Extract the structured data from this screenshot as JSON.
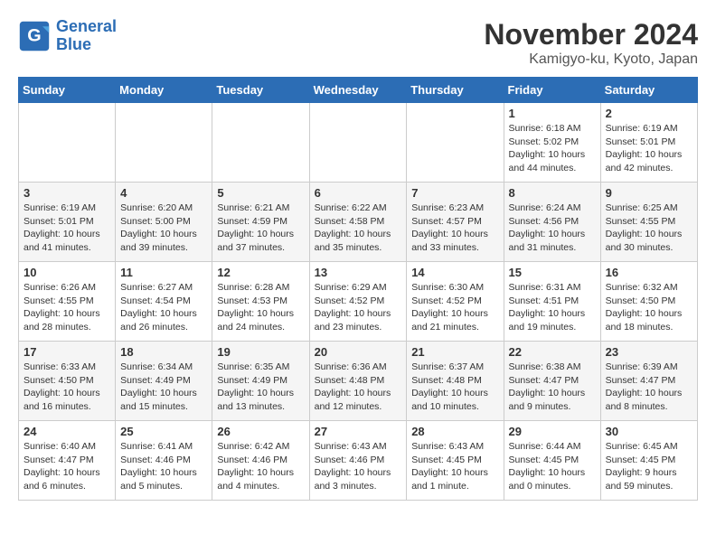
{
  "logo": {
    "line1": "General",
    "line2": "Blue"
  },
  "title": "November 2024",
  "subtitle": "Kamigyo-ku, Kyoto, Japan",
  "weekdays": [
    "Sunday",
    "Monday",
    "Tuesday",
    "Wednesday",
    "Thursday",
    "Friday",
    "Saturday"
  ],
  "weeks": [
    [
      {
        "day": "",
        "info": ""
      },
      {
        "day": "",
        "info": ""
      },
      {
        "day": "",
        "info": ""
      },
      {
        "day": "",
        "info": ""
      },
      {
        "day": "",
        "info": ""
      },
      {
        "day": "1",
        "info": "Sunrise: 6:18 AM\nSunset: 5:02 PM\nDaylight: 10 hours and 44 minutes."
      },
      {
        "day": "2",
        "info": "Sunrise: 6:19 AM\nSunset: 5:01 PM\nDaylight: 10 hours and 42 minutes."
      }
    ],
    [
      {
        "day": "3",
        "info": "Sunrise: 6:19 AM\nSunset: 5:01 PM\nDaylight: 10 hours and 41 minutes."
      },
      {
        "day": "4",
        "info": "Sunrise: 6:20 AM\nSunset: 5:00 PM\nDaylight: 10 hours and 39 minutes."
      },
      {
        "day": "5",
        "info": "Sunrise: 6:21 AM\nSunset: 4:59 PM\nDaylight: 10 hours and 37 minutes."
      },
      {
        "day": "6",
        "info": "Sunrise: 6:22 AM\nSunset: 4:58 PM\nDaylight: 10 hours and 35 minutes."
      },
      {
        "day": "7",
        "info": "Sunrise: 6:23 AM\nSunset: 4:57 PM\nDaylight: 10 hours and 33 minutes."
      },
      {
        "day": "8",
        "info": "Sunrise: 6:24 AM\nSunset: 4:56 PM\nDaylight: 10 hours and 31 minutes."
      },
      {
        "day": "9",
        "info": "Sunrise: 6:25 AM\nSunset: 4:55 PM\nDaylight: 10 hours and 30 minutes."
      }
    ],
    [
      {
        "day": "10",
        "info": "Sunrise: 6:26 AM\nSunset: 4:55 PM\nDaylight: 10 hours and 28 minutes."
      },
      {
        "day": "11",
        "info": "Sunrise: 6:27 AM\nSunset: 4:54 PM\nDaylight: 10 hours and 26 minutes."
      },
      {
        "day": "12",
        "info": "Sunrise: 6:28 AM\nSunset: 4:53 PM\nDaylight: 10 hours and 24 minutes."
      },
      {
        "day": "13",
        "info": "Sunrise: 6:29 AM\nSunset: 4:52 PM\nDaylight: 10 hours and 23 minutes."
      },
      {
        "day": "14",
        "info": "Sunrise: 6:30 AM\nSunset: 4:52 PM\nDaylight: 10 hours and 21 minutes."
      },
      {
        "day": "15",
        "info": "Sunrise: 6:31 AM\nSunset: 4:51 PM\nDaylight: 10 hours and 19 minutes."
      },
      {
        "day": "16",
        "info": "Sunrise: 6:32 AM\nSunset: 4:50 PM\nDaylight: 10 hours and 18 minutes."
      }
    ],
    [
      {
        "day": "17",
        "info": "Sunrise: 6:33 AM\nSunset: 4:50 PM\nDaylight: 10 hours and 16 minutes."
      },
      {
        "day": "18",
        "info": "Sunrise: 6:34 AM\nSunset: 4:49 PM\nDaylight: 10 hours and 15 minutes."
      },
      {
        "day": "19",
        "info": "Sunrise: 6:35 AM\nSunset: 4:49 PM\nDaylight: 10 hours and 13 minutes."
      },
      {
        "day": "20",
        "info": "Sunrise: 6:36 AM\nSunset: 4:48 PM\nDaylight: 10 hours and 12 minutes."
      },
      {
        "day": "21",
        "info": "Sunrise: 6:37 AM\nSunset: 4:48 PM\nDaylight: 10 hours and 10 minutes."
      },
      {
        "day": "22",
        "info": "Sunrise: 6:38 AM\nSunset: 4:47 PM\nDaylight: 10 hours and 9 minutes."
      },
      {
        "day": "23",
        "info": "Sunrise: 6:39 AM\nSunset: 4:47 PM\nDaylight: 10 hours and 8 minutes."
      }
    ],
    [
      {
        "day": "24",
        "info": "Sunrise: 6:40 AM\nSunset: 4:47 PM\nDaylight: 10 hours and 6 minutes."
      },
      {
        "day": "25",
        "info": "Sunrise: 6:41 AM\nSunset: 4:46 PM\nDaylight: 10 hours and 5 minutes."
      },
      {
        "day": "26",
        "info": "Sunrise: 6:42 AM\nSunset: 4:46 PM\nDaylight: 10 hours and 4 minutes."
      },
      {
        "day": "27",
        "info": "Sunrise: 6:43 AM\nSunset: 4:46 PM\nDaylight: 10 hours and 3 minutes."
      },
      {
        "day": "28",
        "info": "Sunrise: 6:43 AM\nSunset: 4:45 PM\nDaylight: 10 hours and 1 minute."
      },
      {
        "day": "29",
        "info": "Sunrise: 6:44 AM\nSunset: 4:45 PM\nDaylight: 10 hours and 0 minutes."
      },
      {
        "day": "30",
        "info": "Sunrise: 6:45 AM\nSunset: 4:45 PM\nDaylight: 9 hours and 59 minutes."
      }
    ]
  ]
}
